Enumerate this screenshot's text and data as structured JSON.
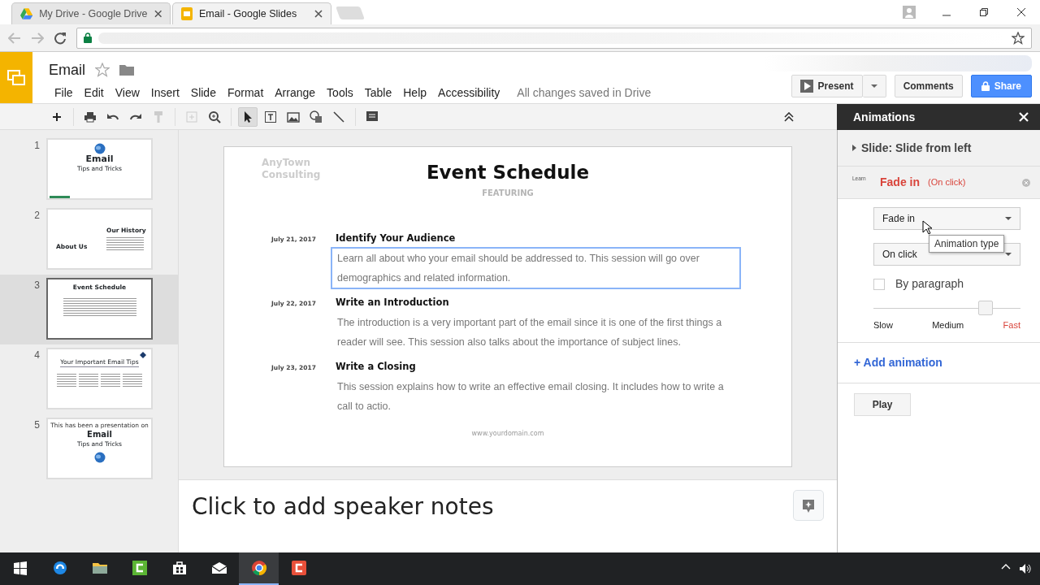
{
  "browser": {
    "tabs": [
      {
        "title": "My Drive - Google Drive",
        "kind": "drive",
        "selected": false
      },
      {
        "title": "Email - Google Slides",
        "kind": "slides",
        "selected": true
      }
    ]
  },
  "doc": {
    "title": "Email",
    "starred": false
  },
  "menu": [
    "File",
    "Edit",
    "View",
    "Insert",
    "Slide",
    "Format",
    "Arrange",
    "Tools",
    "Table",
    "Help",
    "Accessibility"
  ],
  "save_status": "All changes saved in Drive",
  "buttons": {
    "present": "Present",
    "comments": "Comments",
    "share": "Share"
  },
  "toolbar": [
    {
      "kind": "new",
      "selected": false
    },
    {
      "kind": "print",
      "selected": false
    },
    {
      "kind": "undo",
      "selected": false
    },
    {
      "kind": "redo",
      "selected": false
    },
    {
      "kind": "paint",
      "selected": false
    },
    {
      "kind": "fit",
      "selected": false
    },
    {
      "kind": "zoom",
      "selected": false
    },
    {
      "kind": "select",
      "selected": true
    },
    {
      "kind": "textbox",
      "selected": false
    },
    {
      "kind": "image",
      "selected": false
    },
    {
      "kind": "shape",
      "selected": false
    },
    {
      "kind": "line",
      "selected": false
    },
    {
      "kind": "comment",
      "selected": false
    }
  ],
  "slides": [
    {
      "number": "1",
      "kind": "title",
      "selected": false,
      "texts": [
        "Email",
        "Tips and Tricks"
      ]
    },
    {
      "number": "2",
      "kind": "about",
      "selected": false,
      "texts": [
        "About Us",
        "Our History"
      ]
    },
    {
      "number": "3",
      "kind": "schedule",
      "selected": true,
      "texts": [
        "Event Schedule"
      ]
    },
    {
      "number": "4",
      "kind": "tips",
      "selected": false,
      "texts": [
        "Your Important Email Tips"
      ]
    },
    {
      "number": "5",
      "kind": "closing",
      "selected": false,
      "texts": [
        "This has been a presentation on",
        "Email",
        "Tips and Tricks"
      ]
    }
  ],
  "slide": {
    "logo": "AnyTown Consulting",
    "title": "Event Schedule",
    "subtitle": "FEATURING",
    "footer": "www.yourdomain.com",
    "events": [
      {
        "date": "July 21, 2017",
        "heading": "Identify Your Audience",
        "text": "Learn all about who your email should be addressed to. This session will go over demographics and related information.",
        "selected": true
      },
      {
        "date": "July 22, 2017",
        "heading": "Write an Introduction",
        "text": "The introduction is a very important part of the email since it is one of the first things a reader will see. This session also talks about the importance of subject lines.",
        "selected": false
      },
      {
        "date": "July 23, 2017",
        "heading": "Write a Closing",
        "text": "This session explains how to write an effective email closing. It includes how to write a call to actio.",
        "selected": false
      }
    ]
  },
  "speaker_notes": {
    "placeholder": "Click to add speaker notes"
  },
  "animations": {
    "title": "Animations",
    "items": [
      {
        "title": "Slide: Slide from left",
        "expanded": false
      },
      {
        "target": "Learn",
        "effect": "Fade in",
        "trigger": "(On click)",
        "expanded": true,
        "type": "Fade in",
        "start": "On click",
        "by_paragraph": false,
        "by_paragraph_label": "By paragraph",
        "speed": {
          "level": 0.76,
          "labels": [
            {
              "label": "Slow",
              "selected": false
            },
            {
              "label": "Medium",
              "selected": false
            },
            {
              "label": "Fast",
              "selected": true
            }
          ]
        }
      }
    ],
    "add": "+ Add animation",
    "play": "Play"
  },
  "tooltip": "Animation type",
  "taskbar": [
    {
      "kind": "windows",
      "active": false
    },
    {
      "kind": "edge",
      "active": false
    },
    {
      "kind": "folder",
      "active": false
    },
    {
      "kind": "camtasia",
      "active": false
    },
    {
      "kind": "store",
      "active": false
    },
    {
      "kind": "mail",
      "active": false
    },
    {
      "kind": "chrome",
      "active": true
    },
    {
      "kind": "recorder",
      "active": false
    }
  ]
}
